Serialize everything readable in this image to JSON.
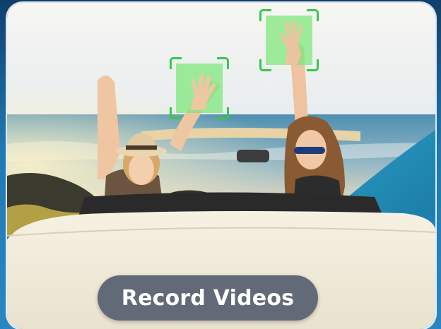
{
  "caption": {
    "label": "Record Videos"
  },
  "gestures": {
    "left": {
      "icon": "raised-hand-icon"
    },
    "right": {
      "icon": "raised-hand-icon"
    }
  },
  "colors": {
    "detection_fill": "#7ce878",
    "detection_bracket": "#37c84a",
    "caption_bg": "#576070",
    "caption_text": "#ffffff",
    "frame_border": "#ffffff"
  }
}
